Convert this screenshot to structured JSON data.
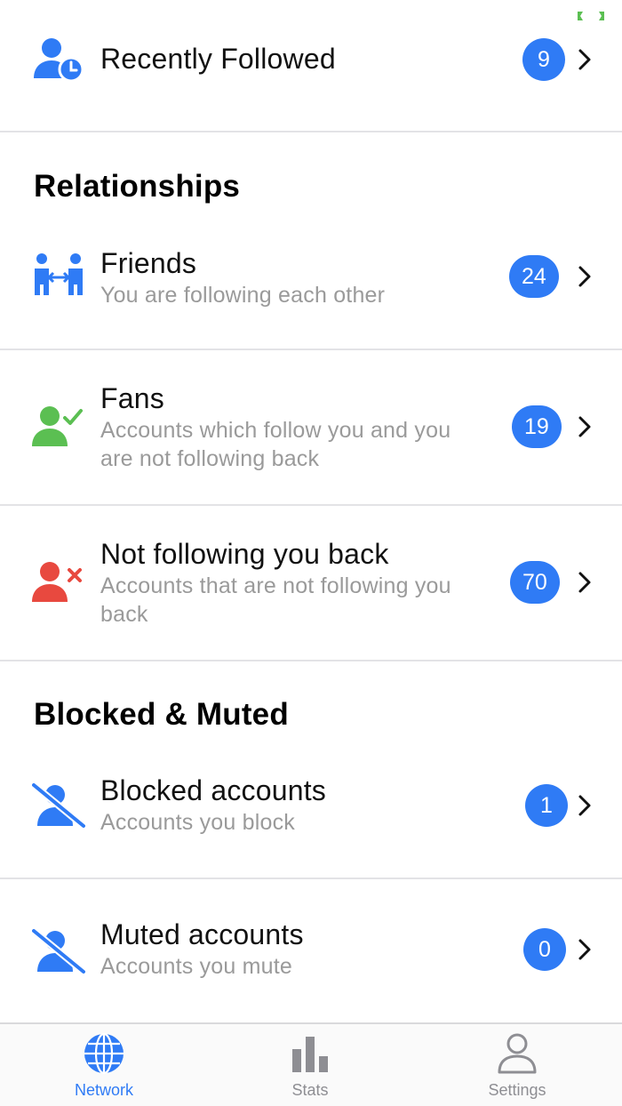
{
  "colors": {
    "accent": "#2f7bf5",
    "fans_green": "#5bbf52",
    "not_following_red": "#e8493f"
  },
  "rows": {
    "recently_followed": {
      "title": "Recently Followed",
      "count": "9",
      "icon": "user-clock-icon"
    },
    "friends": {
      "title": "Friends",
      "subtitle": "You are following each other",
      "count": "24",
      "icon": "friends-icon"
    },
    "fans": {
      "title": "Fans",
      "subtitle": "Accounts which follow you and you are not following back",
      "count": "19",
      "icon": "user-check-icon"
    },
    "not_following_back": {
      "title": "Not following you back",
      "subtitle": "Accounts that are not following you back",
      "count": "70",
      "icon": "user-x-icon"
    },
    "blocked": {
      "title": "Blocked accounts",
      "subtitle": "Accounts you block",
      "count": "1",
      "icon": "user-slash-icon"
    },
    "muted": {
      "title": "Muted accounts",
      "subtitle": "Accounts you mute",
      "count": "0",
      "icon": "user-slash-icon"
    }
  },
  "sections": {
    "relationships": "Relationships",
    "blocked_muted": "Blocked & Muted"
  },
  "tabs": [
    {
      "label": "Network",
      "icon": "globe-icon",
      "active": true
    },
    {
      "label": "Stats",
      "icon": "bar-chart-icon",
      "active": false
    },
    {
      "label": "Settings",
      "icon": "person-icon",
      "active": false
    }
  ]
}
